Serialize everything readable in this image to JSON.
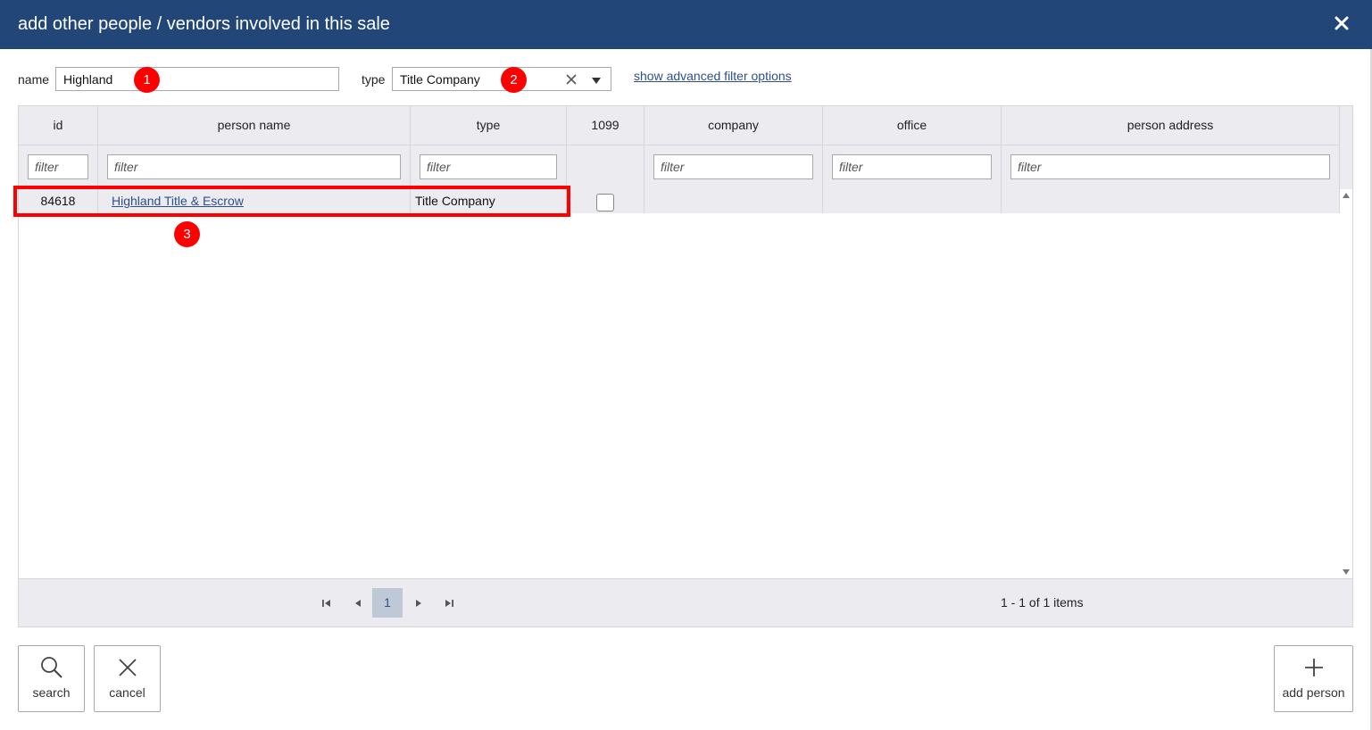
{
  "dialog": {
    "title": "add other people / vendors involved in this sale",
    "close_icon": "close-icon"
  },
  "filters": {
    "name_label": "name",
    "name_value": "Highland",
    "type_label": "type",
    "type_value": "Title Company",
    "advanced_link": "show advanced filter options"
  },
  "markers": [
    "1",
    "2",
    "3"
  ],
  "grid": {
    "columns": [
      "id",
      "person name",
      "type",
      "1099",
      "company",
      "office",
      "person address"
    ],
    "filter_placeholder": "filter",
    "rows": [
      {
        "id": "84618",
        "person_name": "Highland Title & Escrow",
        "type": "Title Company",
        "is_1099": false,
        "company": "",
        "office": "",
        "person_address": ""
      }
    ]
  },
  "pager": {
    "current_page": "1",
    "info": "1 - 1 of 1 items"
  },
  "buttons": {
    "search": "search",
    "cancel": "cancel",
    "add_person": "add person"
  },
  "colors": {
    "titlebar": "#214677",
    "link": "#2e4f8a",
    "marker": "#ff0000",
    "grid_header": "#ebebf0"
  }
}
